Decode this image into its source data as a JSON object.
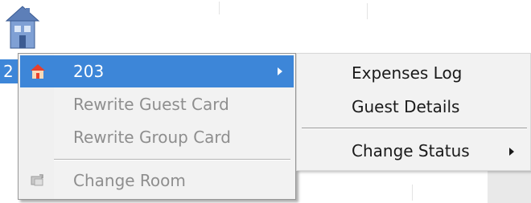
{
  "room_tile": {
    "icon": "house-icon",
    "label_partial": "2"
  },
  "context_menu": {
    "items": [
      {
        "label": "203",
        "icon": "house-icon",
        "state": "highlighted",
        "has_submenu": true
      },
      {
        "label": "Rewrite Guest Card",
        "state": "disabled"
      },
      {
        "label": "Rewrite Group Card",
        "state": "disabled"
      },
      {
        "label": "Change Room",
        "icon": "change-room-icon",
        "state": "disabled"
      }
    ]
  },
  "sub_menu": {
    "items": [
      {
        "label": "Expenses Log"
      },
      {
        "label": "Guest Details"
      },
      {
        "label": "Change Status",
        "has_submenu": true
      }
    ]
  },
  "colors": {
    "highlight": "#3d86d8",
    "menu_background": "#f2f2f2",
    "disabled_text": "#8e8e8e",
    "house_roof": "#e8402c"
  }
}
